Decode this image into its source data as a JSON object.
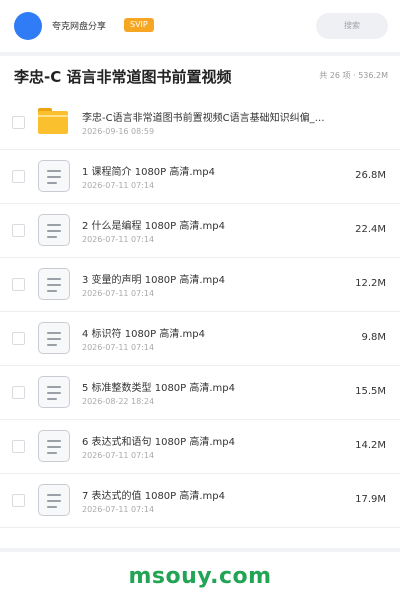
{
  "header": {
    "user_name": "夸克网盘分享",
    "badge": "SVIP",
    "search_placeholder": "搜索"
  },
  "title_bar": {
    "title": "李忠-C 语言非常道图书前置视频",
    "summary": "共 26 项 · 536.2M"
  },
  "files": [
    {
      "type": "folder",
      "name": "李忠-C语言非常道图书前置视频C语言基础知识纠偏_…",
      "date": "2026-09-16 08:59",
      "size": ""
    },
    {
      "type": "video",
      "name": "1 课程简介 1080P 高清.mp4",
      "date": "2026-07-11 07:14",
      "size": "26.8M"
    },
    {
      "type": "video",
      "name": "2 什么是编程 1080P 高清.mp4",
      "date": "2026-07-11 07:14",
      "size": "22.4M"
    },
    {
      "type": "video",
      "name": "3 变量的声明 1080P 高清.mp4",
      "date": "2026-07-11 07:14",
      "size": "12.2M"
    },
    {
      "type": "video",
      "name": "4 标识符 1080P 高清.mp4",
      "date": "2026-07-11 07:14",
      "size": "9.8M"
    },
    {
      "type": "video",
      "name": "5 标准整数类型 1080P 高清.mp4",
      "date": "2026-08-22 18:24",
      "size": "15.5M"
    },
    {
      "type": "video",
      "name": "6 表达式和语句 1080P 高清.mp4",
      "date": "2026-07-11 07:14",
      "size": "14.2M"
    },
    {
      "type": "video",
      "name": "7 表达式的值 1080P 高清.mp4",
      "date": "2026-07-11 07:14",
      "size": "17.9M"
    }
  ],
  "footer": {
    "watermark": "msouy.com"
  },
  "colors": {
    "avatar": "#2f7cf6",
    "svip_badge": "#f6a623",
    "folder": "#fbc02d",
    "watermark": "#21a453"
  }
}
